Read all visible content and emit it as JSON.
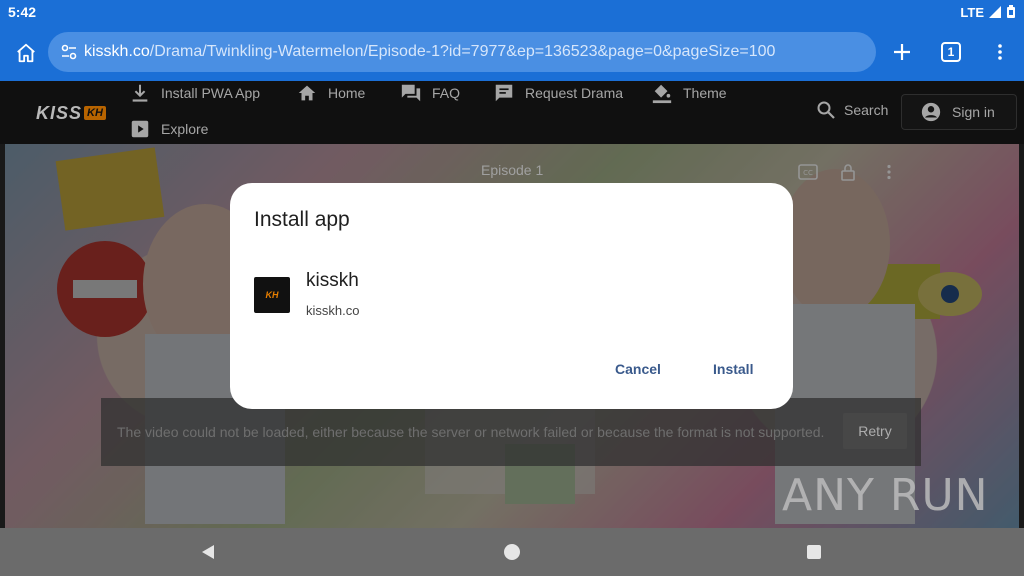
{
  "status_bar": {
    "time": "5:42",
    "network": "LTE"
  },
  "browser": {
    "url_host": "kisskh.co",
    "url_path": "/Drama/Twinkling-Watermelon/Episode-1?id=7977&ep=136523&page=0&pageSize=100",
    "tab_count": "1"
  },
  "site": {
    "logo_text": "KISS",
    "logo_badge": "KH",
    "nav": [
      {
        "label": "Install PWA App",
        "icon": "download-icon"
      },
      {
        "label": "Home",
        "icon": "home-icon"
      },
      {
        "label": "FAQ",
        "icon": "forum-icon"
      },
      {
        "label": "Request Drama",
        "icon": "chat-icon"
      },
      {
        "label": "Theme",
        "icon": "paint-bucket-icon"
      },
      {
        "label": "Explore",
        "icon": "play-box-icon"
      }
    ],
    "search_label": "Search",
    "signin_label": "Sign in"
  },
  "player": {
    "episode_label": "Episode 1",
    "error_message": "The video could not be loaded, either because the server or network failed or because the format is not supported.",
    "retry_label": "Retry",
    "watermark": "ANY RUN"
  },
  "dialog": {
    "title": "Install app",
    "app_name": "kisskh",
    "app_url": "kisskh.co",
    "cancel_label": "Cancel",
    "install_label": "Install"
  },
  "colors": {
    "chrome_blue": "#1b6fd6",
    "accent_orange": "#e67e00",
    "dialog_button": "#3a5a8c"
  }
}
